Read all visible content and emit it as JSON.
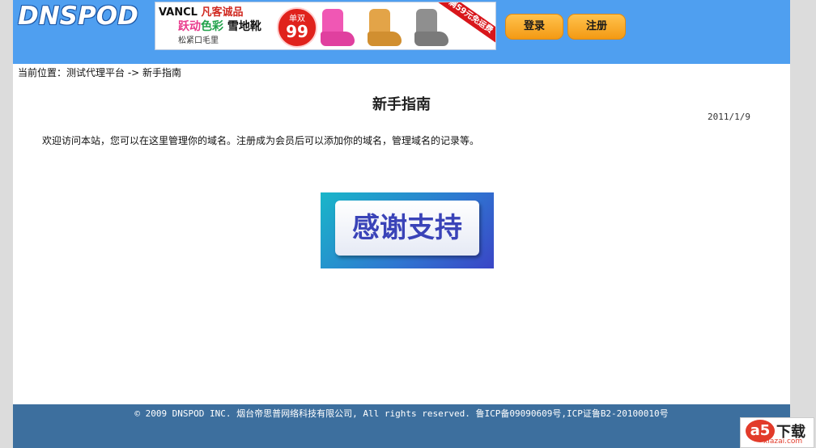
{
  "header": {
    "logo_text": "DNSPOD",
    "login_label": "登录",
    "register_label": "注册",
    "accent_color": "#4f9ff0",
    "button_color": "#f39a14"
  },
  "banner": {
    "brand": "VANCL",
    "brand_tag": "凡客诚品",
    "tagline_a": "跃动",
    "tagline_b": "色彩",
    "product": "雪地靴",
    "subline": "松紧口毛里",
    "badge_top": "单双",
    "badge_price": "99",
    "ribbon": "满59元免运费"
  },
  "breadcrumb": {
    "prefix": "当前位置：",
    "home_link": "测试代理平台",
    "separator": " -> ",
    "current": "新手指南"
  },
  "article": {
    "title": "新手指南",
    "date": "2011/1/9",
    "body": "欢迎访问本站，您可以在这里管理你的域名。注册成为会员后可以添加你的域名，管理域名的记录等。",
    "thanks_image_text": "感谢支持"
  },
  "footer": {
    "copyright": "© 2009 DNSPOD INC. 烟台帝思普网络科技有限公司, All rights reserved. 鲁ICP备09090609号,ICP证鲁B2-20100010号",
    "color": "#3d6f9e"
  },
  "watermark": {
    "mark": "a5",
    "text": "下载",
    "domain": "xiazai.com"
  }
}
